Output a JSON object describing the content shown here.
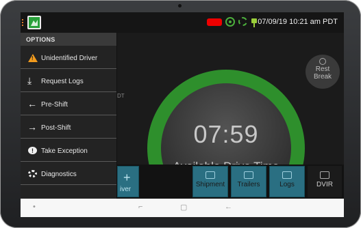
{
  "status_bar": {
    "datetime": "07/09/19 10:21 am PDT",
    "icons": [
      "app-logo-icon",
      "truck-icon",
      "gps-icon",
      "cellular-icon",
      "power-plug-icon"
    ],
    "colors": {
      "truck": "#e00000",
      "gps": "#4caf3c",
      "plug": "#9bcf3a"
    }
  },
  "main": {
    "countdown": "07:59",
    "countdown_label": "Available Drive Time",
    "rest_break": {
      "line1": "Rest",
      "line2": "Break"
    },
    "partial_tag": "DT",
    "ring_color": "#2e8f2c"
  },
  "drawer": {
    "header": "OPTIONS",
    "items": [
      {
        "label": "Unidentified Driver",
        "icon": "warning-icon"
      },
      {
        "label": "Request Logs",
        "icon": "download-icon"
      },
      {
        "label": "Pre-Shift",
        "icon": "arrow-left-icon"
      },
      {
        "label": "Post-Shift",
        "icon": "arrow-right-icon"
      },
      {
        "label": "Take Exception",
        "icon": "exclamation-icon"
      },
      {
        "label": "Diagnostics",
        "icon": "gear-icon"
      }
    ]
  },
  "toolbar": {
    "driver_partial": "iver",
    "shipment": "Shipment",
    "trailers": "Trailers",
    "logs": "Logs",
    "dvir": "DVIR",
    "accent": "#2a6f82"
  },
  "navbar": {
    "recent": "□",
    "home": "▭",
    "back": "←"
  }
}
